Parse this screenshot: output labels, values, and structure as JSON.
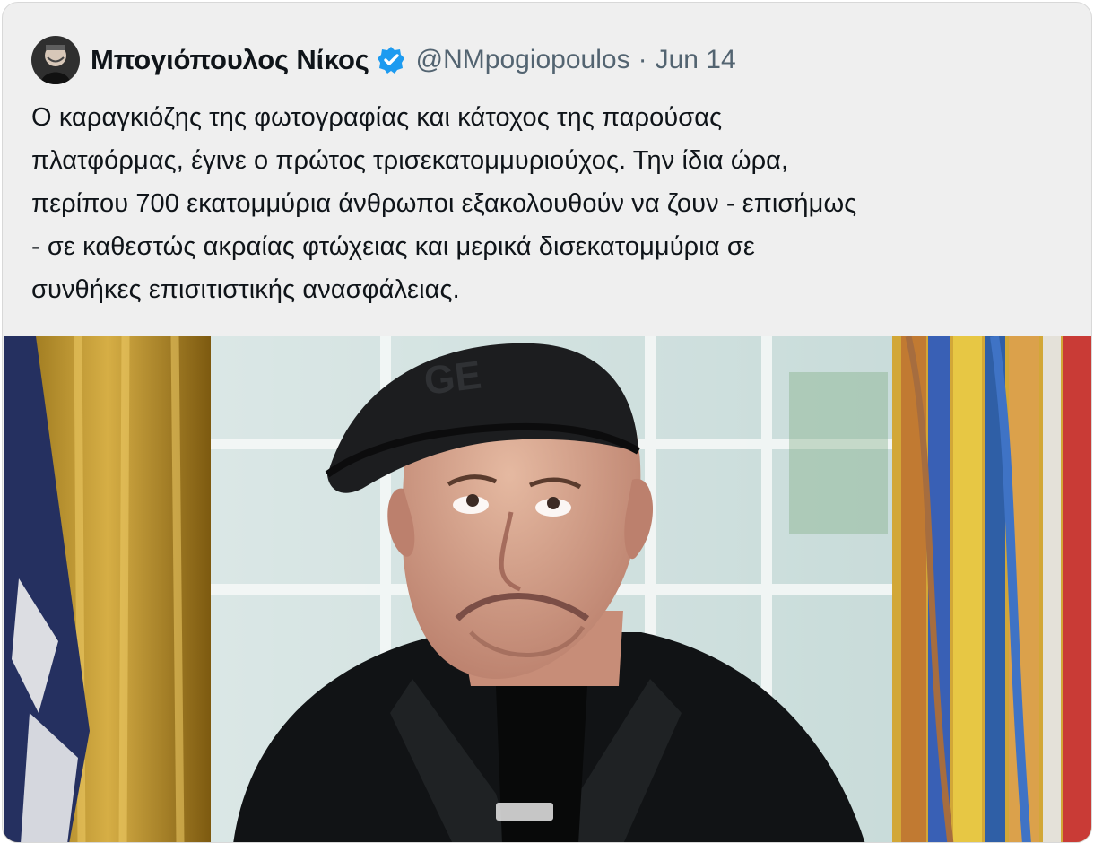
{
  "tweet": {
    "author": {
      "display_name": "Μπογιόπουλος Νίκος",
      "handle": "@NMpogiopoulos",
      "verified": true
    },
    "separator": "·",
    "date": "Jun 14",
    "text": "Ο καραγκιόζης της φωτογραφίας και κάτοχος της παρούσας\nπλατφόρμας, έγινε ο πρώτος τρισεκατομμυριούχος. Την ίδια ώρα,\nπερίπου 700 εκατομμύρια άνθρωποι εξακολουθούν να ζουν - επισήμως\n- σε καθεστώς ακραίας φτώχειας και μερικά δισεκατομμύρια σε\nσυνθήκες επισιτιστικής ανασφάλειας."
  },
  "colors": {
    "card_background": "#efefef",
    "text_primary": "#0f1419",
    "text_secondary": "#536471",
    "verified_blue": "#1d9bf0"
  },
  "icons": {
    "verified": "verified-badge-icon"
  }
}
